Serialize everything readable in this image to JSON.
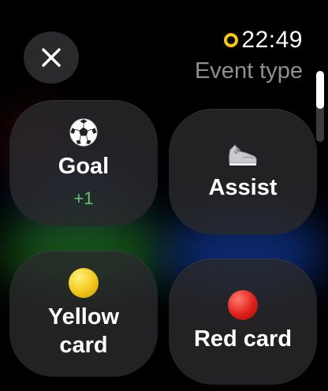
{
  "status": {
    "time": "22:49",
    "ring_color": "#f5c518"
  },
  "header": {
    "title": "Event type",
    "close_icon": "close-icon"
  },
  "tiles": [
    {
      "label": "Goal",
      "sublabel": "+1",
      "icon": "soccer-ball-icon"
    },
    {
      "label": "Assist",
      "icon": "sneaker-icon"
    },
    {
      "label": "Yellow card",
      "icon": "yellow-circle-icon",
      "color": "#f2c61a"
    },
    {
      "label": "Red card",
      "icon": "red-circle-icon",
      "color": "#e0201a"
    }
  ],
  "colors": {
    "score_green": "#5cc96a",
    "tile_bg": "#2a2a2c"
  }
}
